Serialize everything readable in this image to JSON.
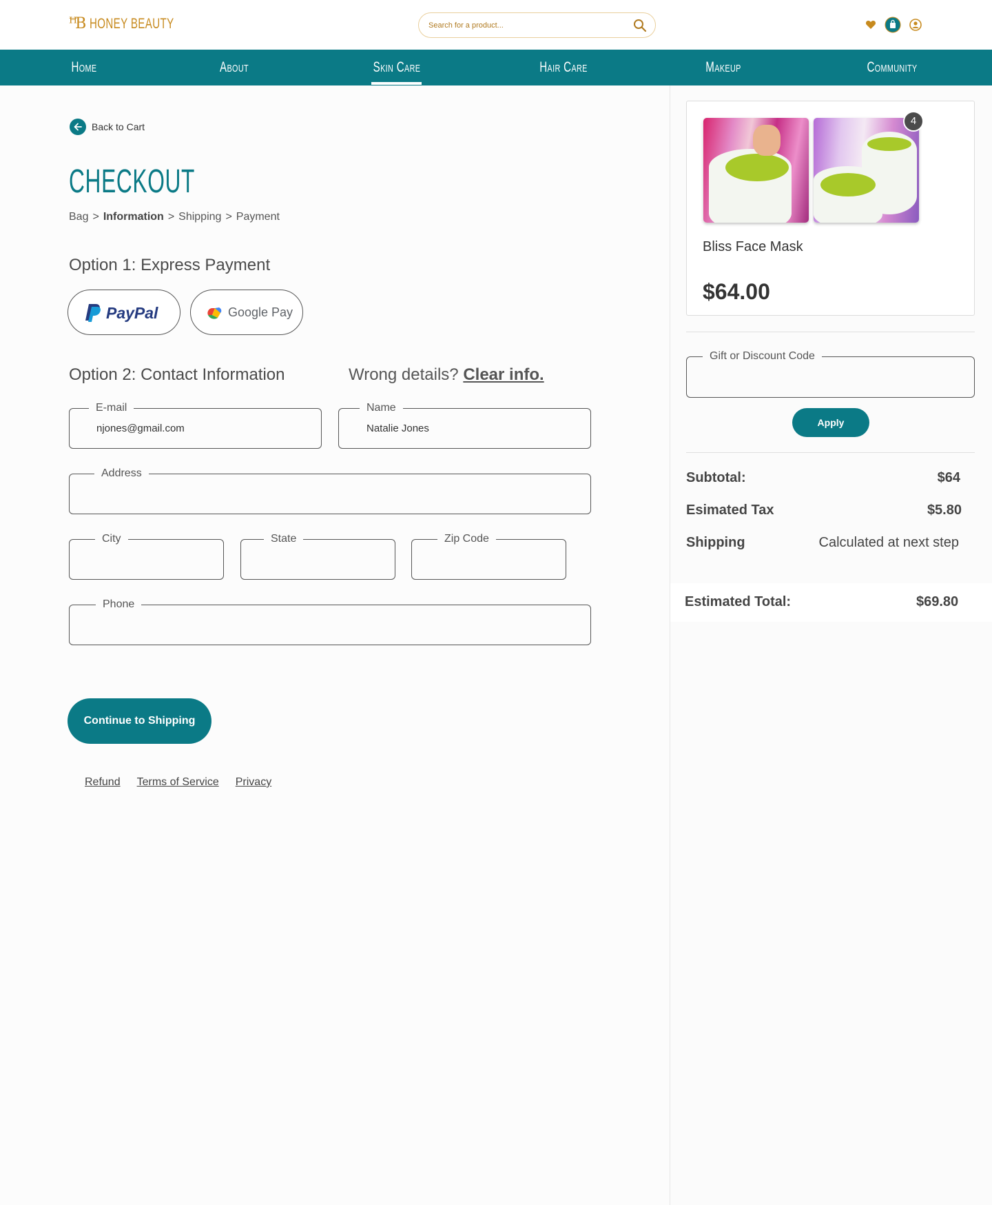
{
  "header": {
    "logo_mark": "ꟸB",
    "logo_text": "HONEY BEAUTY",
    "search_placeholder": "Search for a product...",
    "brand_color": "#c78a1e",
    "icons": [
      "heart-icon",
      "cart-icon",
      "account-icon"
    ]
  },
  "nav": {
    "items": [
      "Home",
      "About",
      "Skin Care",
      "Hair Care",
      "Makeup",
      "Community"
    ],
    "active": "Skin Care",
    "bg_color": "#0b7a86"
  },
  "checkout": {
    "back_label": "Back to Cart",
    "title": "CHECKOUT",
    "breadcrumb": [
      "Bag",
      "Information",
      "Shipping",
      "Payment"
    ],
    "breadcrumb_current": "Information",
    "option1_heading": "Option 1: Express Payment",
    "paypal_label": "PayPal",
    "googlepay_label": "Google Pay",
    "option2_heading": "Option 2: Contact Information",
    "wrong_details": "Wrong details?",
    "clear_info": "Clear info.",
    "fields": {
      "email": {
        "label": "E-mail",
        "value": "njones@gmail.com"
      },
      "name": {
        "label": "Name",
        "value": "Natalie Jones"
      },
      "address": {
        "label": "Address",
        "value": ""
      },
      "city": {
        "label": "City",
        "value": ""
      },
      "state": {
        "label": "State",
        "value": ""
      },
      "zip": {
        "label": "Zip Code",
        "value": ""
      },
      "phone": {
        "label": "Phone",
        "value": ""
      }
    },
    "continue_label": "Continue to Shipping",
    "footer_links": [
      "Refund",
      "Terms of Service",
      "Privacy"
    ]
  },
  "summary": {
    "item_count": "4",
    "product_name": "Bliss Face Mask",
    "product_price": "$64.00",
    "discount_label": "Gift or Discount Code",
    "apply_label": "Apply",
    "subtotal_label": "Subtotal:",
    "subtotal_value": "$64",
    "tax_label": "Esimated Tax",
    "tax_value": "$5.80",
    "shipping_label": "Shipping",
    "shipping_value": "Calculated at next step",
    "total_label": "Estimated Total:",
    "total_value": "$69.80"
  }
}
